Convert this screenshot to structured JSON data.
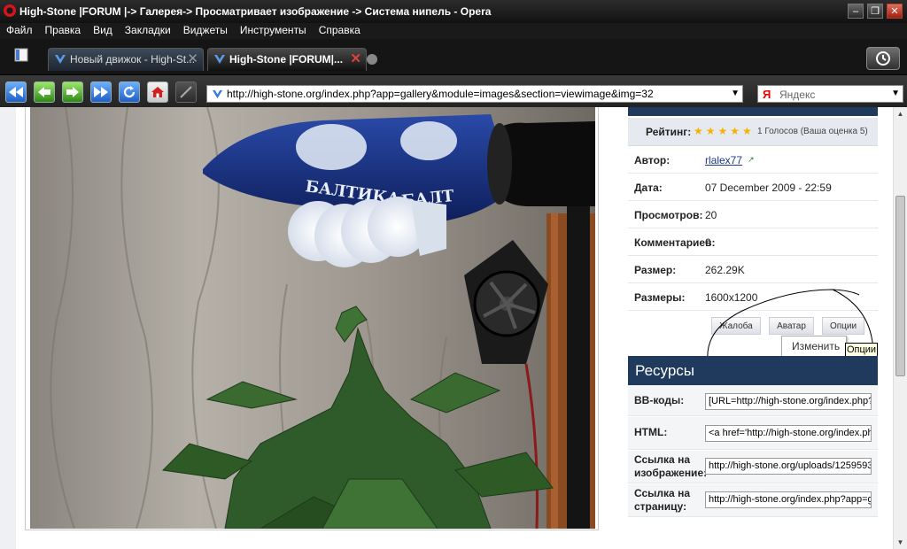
{
  "window": {
    "title": "High-Stone |FORUM |-> Галерея-> Просматривает изображение -> Система нипель - Opera"
  },
  "menu": [
    "Файл",
    "Правка",
    "Вид",
    "Закладки",
    "Виджеты",
    "Инструменты",
    "Справка"
  ],
  "tabs": [
    {
      "label": "Новый движок - High-St..."
    },
    {
      "label": "High-Stone |FORUM|..."
    }
  ],
  "address_bar": {
    "url": "http://high-stone.org/index.php?app=gallery&module=images&section=viewimage&img=32"
  },
  "search_bar": {
    "engine_logo": "Я",
    "placeholder": "Яндекс"
  },
  "photo_caption": {
    "lamp_text_1": "БАЛТИКА",
    "lamp_text_2": "БАЛТ"
  },
  "info": {
    "rating_label": "Рейтинг:",
    "rating_stars": 5,
    "rating_text": "1 Голосов (Ваша оценка 5)",
    "rows": [
      {
        "label": "Автор:",
        "value": "rlalex77"
      },
      {
        "label": "Дата:",
        "value": "07 December 2009 - 22:59"
      },
      {
        "label": "Просмотров:",
        "value": "20"
      },
      {
        "label": "Комментариев:",
        "value": "0"
      },
      {
        "label": "Размер:",
        "value": "262.29K"
      },
      {
        "label": "Размеры:",
        "value": "1600x1200"
      }
    ]
  },
  "actions": {
    "report": "Жалоба",
    "avatar": "Аватар",
    "options": "Опции",
    "options_menu_item": "Изменить",
    "tooltip": "Опции"
  },
  "resources": {
    "title": "Ресурсы",
    "rows": [
      {
        "label": "BB-коды:",
        "value": "[URL=http://high-stone.org/index.php?"
      },
      {
        "label": "HTML:",
        "value": "<a href='http://high-stone.org/index.ph"
      },
      {
        "label": "Ссылка на изображение:",
        "value": "http://high-stone.org/uploads/1259593"
      },
      {
        "label": "Ссылка на страницу:",
        "value": "http://high-stone.org/index.php?app=g"
      }
    ]
  },
  "colors": {
    "accent_header": "#1f3a5c",
    "link": "#1a3a8a"
  }
}
